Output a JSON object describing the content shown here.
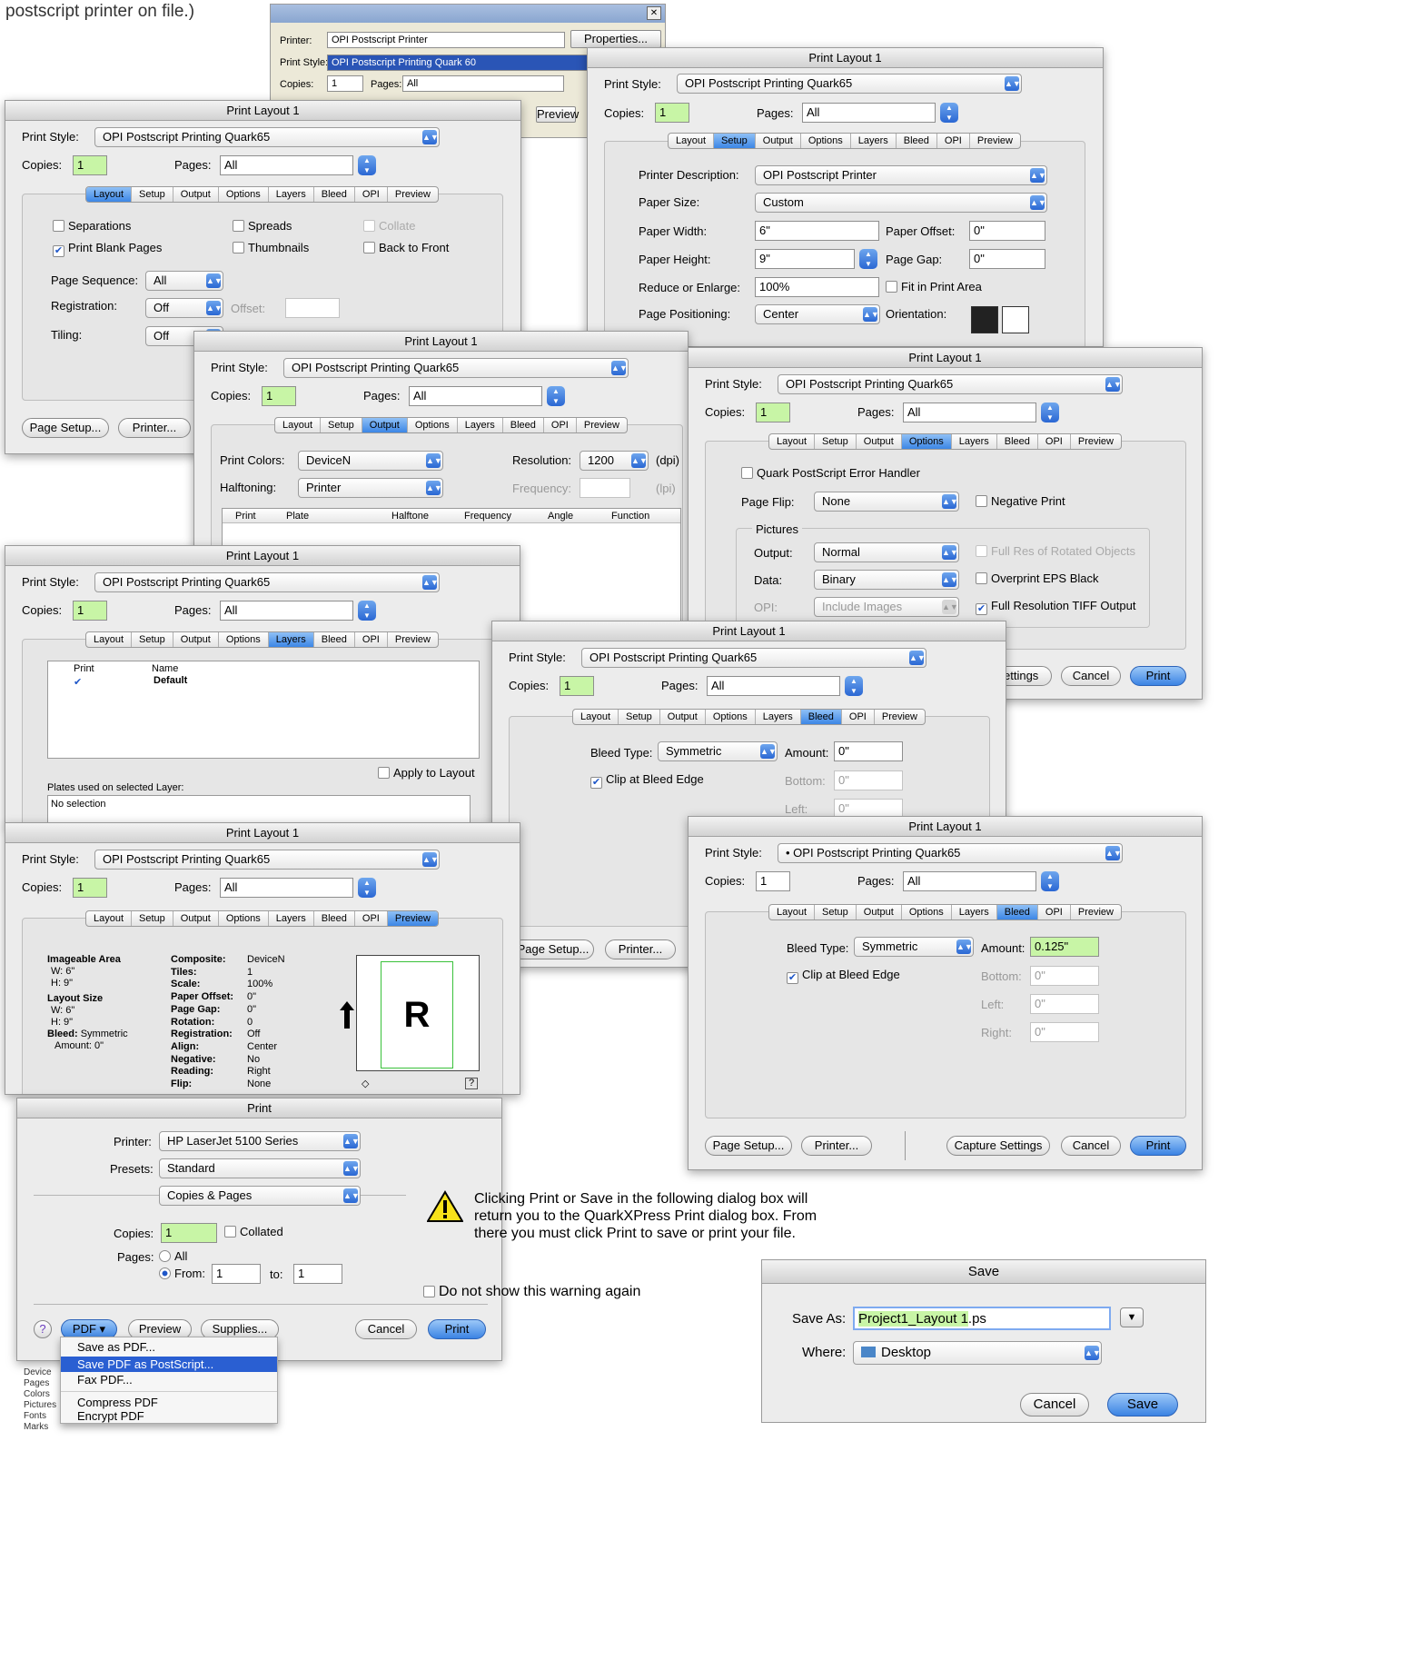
{
  "top_caption": "postscript printer on file.)",
  "xp": {
    "printer_label": "Printer:",
    "printer_value": "OPI Postscript Printer",
    "properties": "Properties...",
    "style_label": "Print Style:",
    "style_value": "OPI Postscript Printing Quark 60",
    "copies_label": "Copies:",
    "copies_value": "1",
    "pages_label": "Pages:",
    "pages_value": "All",
    "preview": "Preview",
    "close": "✕"
  },
  "common": {
    "style_label": "Print Style:",
    "style_value": "OPI Postscript Printing Quark65",
    "style_value_bullet": "• OPI Postscript Printing Quark65",
    "copies_label": "Copies:",
    "copies_value": "1",
    "pages_label": "Pages:",
    "pages_value": "All",
    "title": "Print Layout 1",
    "tabs": [
      "Layout",
      "Setup",
      "Output",
      "Options",
      "Layers",
      "Bleed",
      "OPI",
      "Preview"
    ]
  },
  "layout_tab": {
    "separations": "Separations",
    "spreads": "Spreads",
    "collate": "Collate",
    "print_blank": "Print Blank Pages",
    "thumbnails": "Thumbnails",
    "back_to_front": "Back to Front",
    "page_sequence_label": "Page Sequence:",
    "page_sequence": "All",
    "registration_label": "Registration:",
    "registration": "Off",
    "offset_label": "Offset:",
    "tiling_label": "Tiling:",
    "tiling": "Off",
    "page_setup": "Page Setup...",
    "printer": "Printer..."
  },
  "setup_tab": {
    "printer_desc_label": "Printer Description:",
    "printer_desc": "OPI Postscript Printer",
    "paper_size_label": "Paper Size:",
    "paper_size": "Custom",
    "paper_width_label": "Paper Width:",
    "paper_width": "6\"",
    "paper_offset_label": "Paper Offset:",
    "paper_offset": "0\"",
    "paper_height_label": "Paper Height:",
    "paper_height": "9\"",
    "page_gap_label": "Page Gap:",
    "page_gap": "0\"",
    "reduce_label": "Reduce or Enlarge:",
    "reduce": "100%",
    "fit": "Fit in Print Area",
    "positioning_label": "Page Positioning:",
    "positioning": "Center",
    "orientation_label": "Orientation:"
  },
  "output_tab": {
    "colors_label": "Print Colors:",
    "colors": "DeviceN",
    "resolution_label": "Resolution:",
    "resolution": "1200",
    "dpi": "(dpi)",
    "halftoning_label": "Halftoning:",
    "halftoning": "Printer",
    "frequency_label": "Frequency:",
    "lpi": "(lpi)",
    "columns": [
      "Print",
      "Plate",
      "Halftone",
      "Frequency",
      "Angle",
      "Function"
    ]
  },
  "options_tab": {
    "error_handler": "Quark PostScript Error Handler",
    "flip_label": "Page Flip:",
    "flip": "None",
    "negative": "Negative Print",
    "pictures": "Pictures",
    "output_label": "Output:",
    "output": "Normal",
    "full_res_rot": "Full Res of Rotated Objects",
    "data_label": "Data:",
    "data": "Binary",
    "overprint": "Overprint EPS Black",
    "opi_label": "OPI:",
    "opi": "Include Images",
    "full_tiff": "Full Resolution TIFF Output",
    "settings": "ettings",
    "cancel": "Cancel",
    "print": "Print"
  },
  "layers_tab": {
    "col_print": "Print",
    "col_name": "Name",
    "layer_name": "Default",
    "apply": "Apply to Layout",
    "plates_label": "Plates used on selected Layer:",
    "no_selection": "No selection"
  },
  "bleed1": {
    "type_label": "Bleed Type:",
    "type": "Symmetric",
    "amount_label": "Amount:",
    "amount": "0\"",
    "clip": "Clip at Bleed Edge",
    "bottom_label": "Bottom:",
    "bottom": "0\"",
    "left_label": "Left:",
    "left": "0\"",
    "page_setup": "Page Setup...",
    "printer": "Printer..."
  },
  "bleed2": {
    "type_label": "Bleed Type:",
    "type": "Symmetric",
    "amount_label": "Amount:",
    "amount": "0.125\"",
    "clip": "Clip at Bleed Edge",
    "bottom_label": "Bottom:",
    "bottom": "0\"",
    "left_label": "Left:",
    "left": "0\"",
    "right_label": "Right:",
    "right": "0\"",
    "page_setup": "Page Setup...",
    "printer": "Printer...",
    "capture": "Capture Settings",
    "cancel": "Cancel",
    "print": "Print"
  },
  "preview_tab": {
    "imageable": "Imageable Area",
    "w": "W: 6\"",
    "h": "H: 9\"",
    "layout_size": "Layout Size",
    "lw": "W: 6\"",
    "lh": "H: 9\"",
    "bleed": "Bleed:",
    "bleed_val": "Symmetric",
    "amount": "Amount: 0\"",
    "keys": [
      "Composite:",
      "Tiles:",
      "Scale:",
      "Paper Offset:",
      "Page Gap:",
      "Rotation:",
      "Registration:",
      "Align:",
      "Negative:",
      "Reading:",
      "Flip:"
    ],
    "vals": [
      "DeviceN",
      "1",
      "100%",
      "0\"",
      "0\"",
      "0",
      "Off",
      "Center",
      "No",
      "Right",
      "None"
    ],
    "letter": "R",
    "help": "?"
  },
  "mac_print": {
    "title": "Print",
    "printer_label": "Printer:",
    "printer": "HP LaserJet 5100 Series",
    "presets_label": "Presets:",
    "presets": "Standard",
    "pane": "Copies & Pages",
    "copies_label": "Copies:",
    "copies": "1",
    "collated": "Collated",
    "pages_label": "Pages:",
    "all": "All",
    "from_label": "From:",
    "from": "1",
    "to_label": "to:",
    "to": "1",
    "help": "?",
    "pdf": "PDF ▾",
    "preview": "Preview",
    "supplies": "Supplies...",
    "cancel": "Cancel",
    "print": "Print",
    "menu": [
      "Save as PDF...",
      "Save PDF as PostScript...",
      "Fax PDF...",
      "Compress PDF",
      "Encrypt PDF"
    ],
    "side": [
      "Device",
      "Pages",
      "Colors",
      "Pictures",
      "Fonts",
      "Marks"
    ]
  },
  "warning": {
    "text": "Clicking Print or Save in the following dialog box will return you to the QuarkXPress Print dialog box. From there you must click Print to save or print your file.",
    "dont_show": "Do not show this warning again"
  },
  "save": {
    "title": "Save",
    "save_as_label": "Save As:",
    "filename": "Project1_Layout 1",
    "ext": ".ps",
    "where_label": "Where:",
    "where": "Desktop",
    "cancel": "Cancel",
    "save": "Save"
  },
  "colors": {
    "accent": "#3b83e3",
    "field_green": "#c8f5a6"
  }
}
